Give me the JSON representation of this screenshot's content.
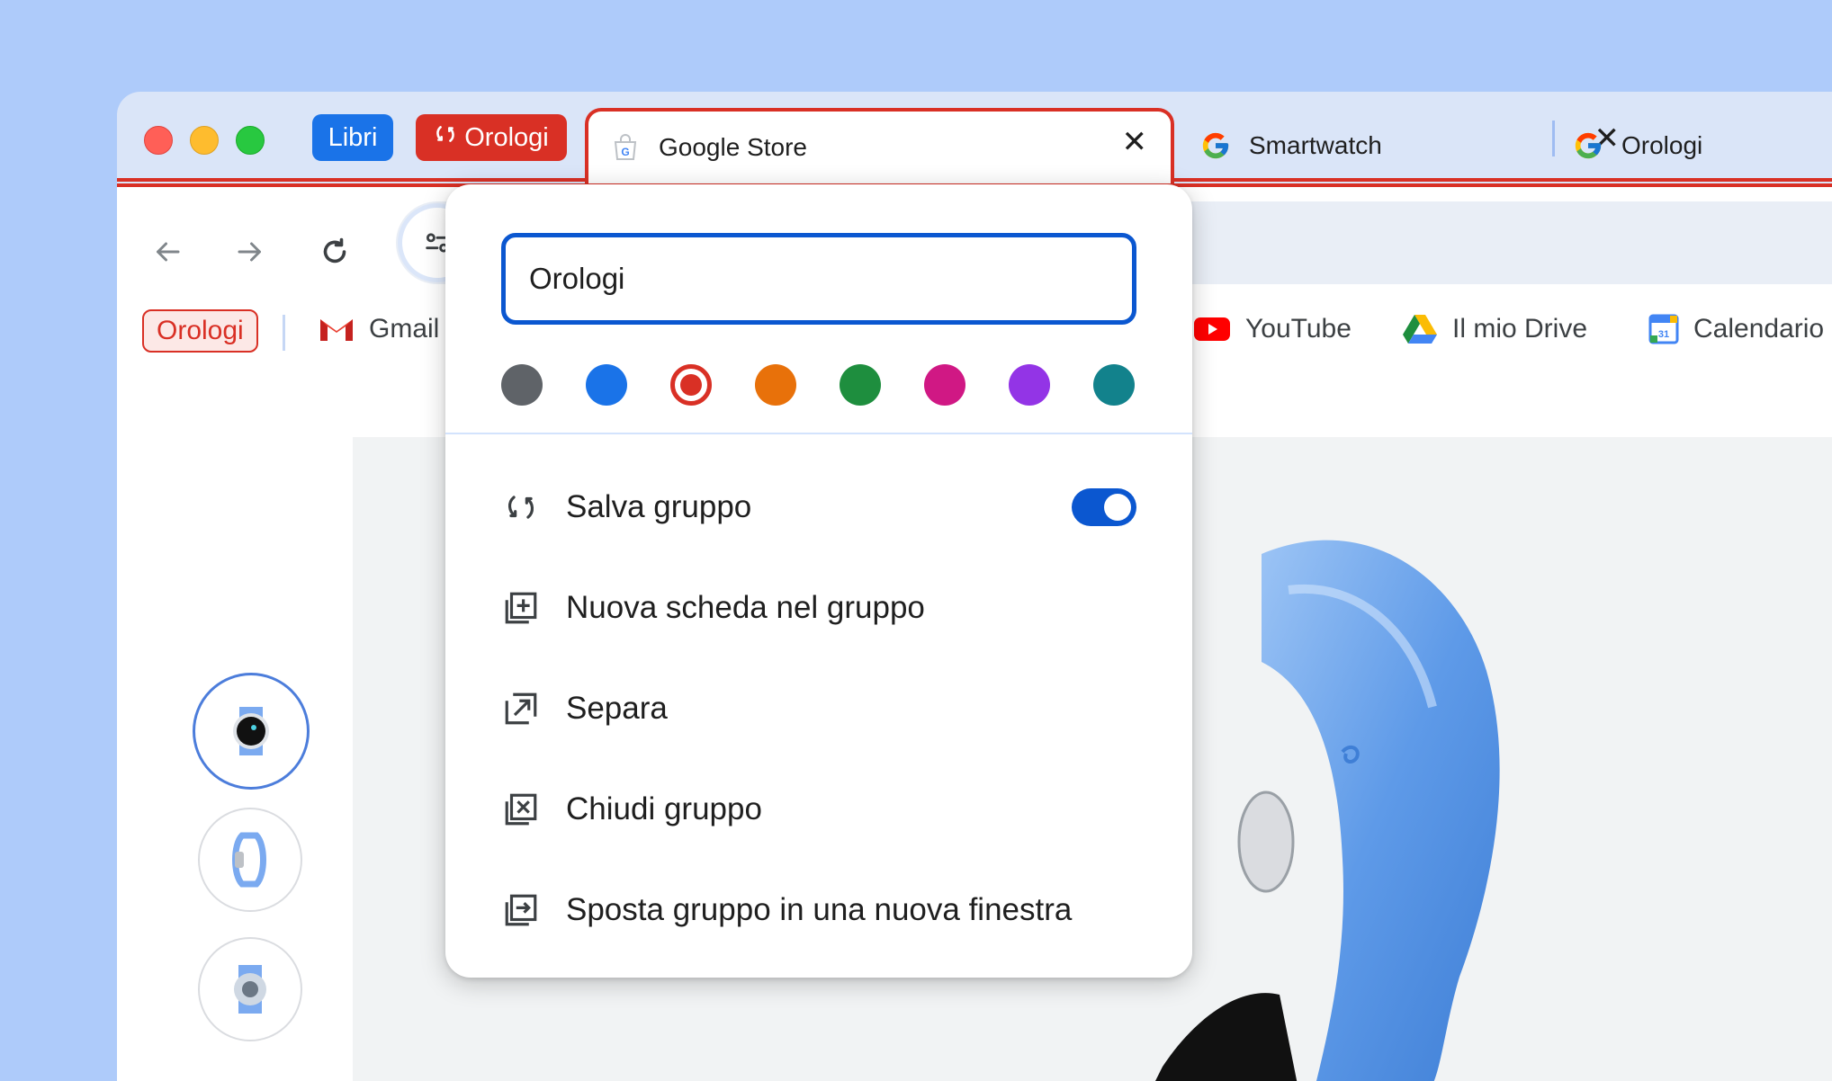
{
  "tab_strip": {
    "groups": [
      {
        "label": "Libri",
        "color": "#1a73e8"
      },
      {
        "label": "Orologi",
        "color": "#d93025"
      }
    ],
    "tabs": [
      {
        "title": "Google Store",
        "favicon": "google-store-icon",
        "close": "✕",
        "active": true
      },
      {
        "title": "Smartwatch",
        "favicon": "google-g-icon",
        "close": "✕",
        "active": false
      },
      {
        "title": "Orologi",
        "favicon": "google-g-icon",
        "active": false
      }
    ]
  },
  "toolbar": {
    "back_icon": "arrow-left-icon",
    "forward_icon": "arrow-right-icon",
    "reload_icon": "reload-icon",
    "site_info_icon": "tune-icon"
  },
  "bookmarks": [
    {
      "label": "Orologi",
      "type": "group"
    },
    {
      "label": "Gmail",
      "icon": "gmail-icon"
    },
    {
      "label": "YouTube",
      "icon": "youtube-icon"
    },
    {
      "label": "Il mio Drive",
      "icon": "drive-icon"
    },
    {
      "label": "Calendario",
      "icon": "calendar-icon"
    }
  ],
  "group_editor": {
    "name_value": "Orologi",
    "colors": [
      "#5f6368",
      "#1a73e8",
      "#d93025",
      "#e8710a",
      "#1e8e3e",
      "#d01884",
      "#9334e6",
      "#12828c"
    ],
    "selected_color": "#d93025",
    "menu": [
      {
        "label": "Salva gruppo",
        "icon": "sync-group-icon",
        "toggle": true,
        "toggle_on": true
      },
      {
        "label": "Nuova scheda nel gruppo",
        "icon": "new-tab-in-group-icon"
      },
      {
        "label": "Separa",
        "icon": "ungroup-icon"
      },
      {
        "label": "Chiudi gruppo",
        "icon": "close-group-icon"
      },
      {
        "label": "Sposta gruppo in una nuova finestra",
        "icon": "move-to-window-icon"
      }
    ]
  }
}
